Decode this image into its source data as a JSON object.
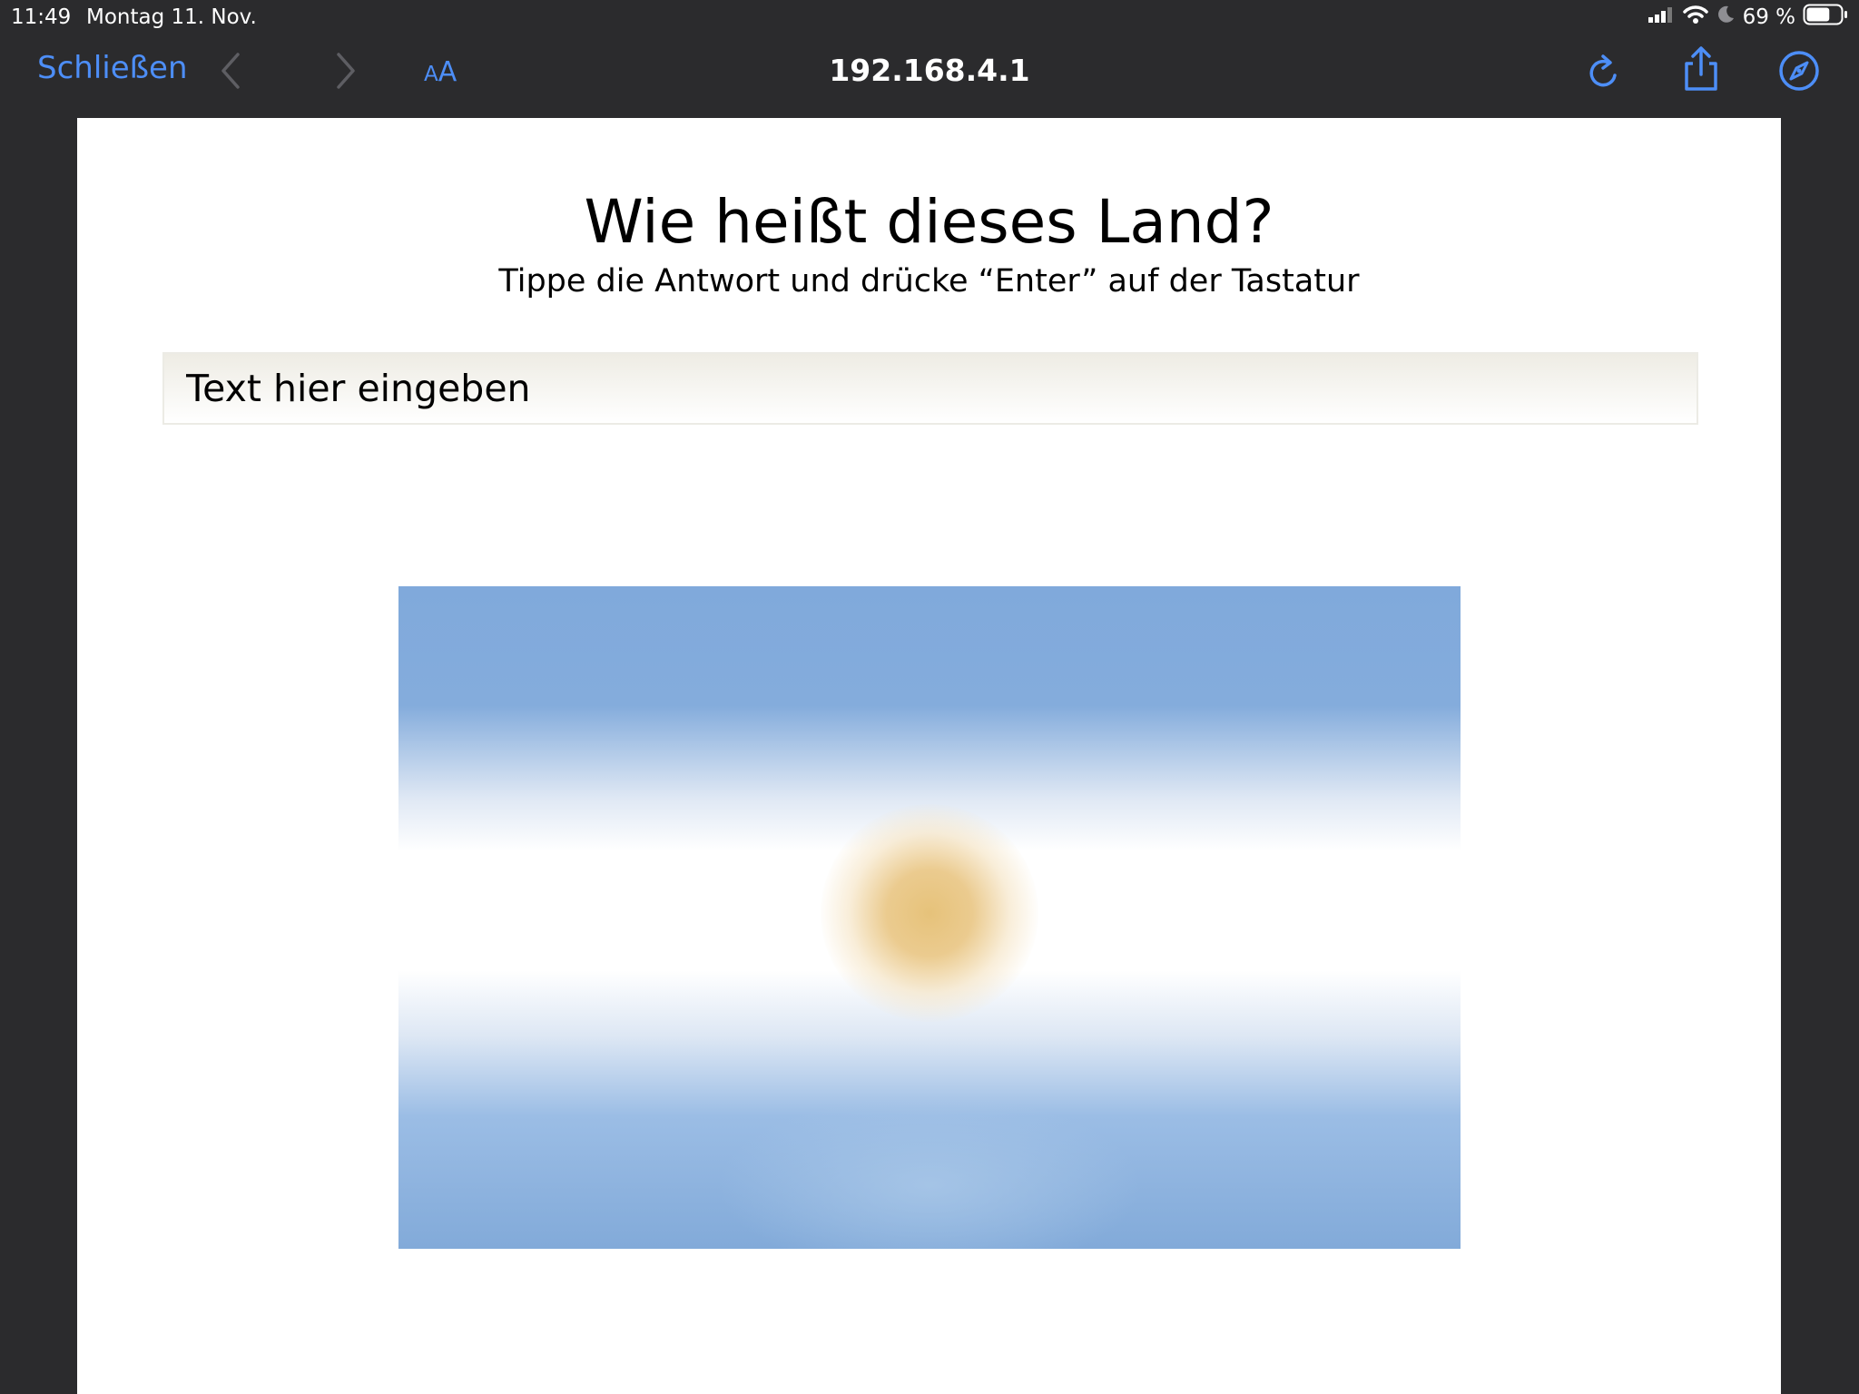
{
  "status": {
    "time": "11:49",
    "date": "Montag 11. Nov.",
    "battery_text": "69 %",
    "battery_level": 0.69
  },
  "toolbar": {
    "close_label": "Schließen",
    "text_size_label_small": "A",
    "text_size_label_large": "A",
    "url": "192.168.4.1",
    "accent_color": "#4d8ef7"
  },
  "quiz": {
    "title": "Wie heißt dieses Land?",
    "subtitle": "Tippe die Antwort und drücke “Enter” auf der Tastatur",
    "input_placeholder": "Text hier eingeben",
    "input_value": ""
  },
  "icons": [
    "signal-icon",
    "wifi-icon",
    "moon-icon",
    "battery-icon",
    "back-icon",
    "forward-icon",
    "reload-icon",
    "share-icon",
    "compass-icon"
  ]
}
